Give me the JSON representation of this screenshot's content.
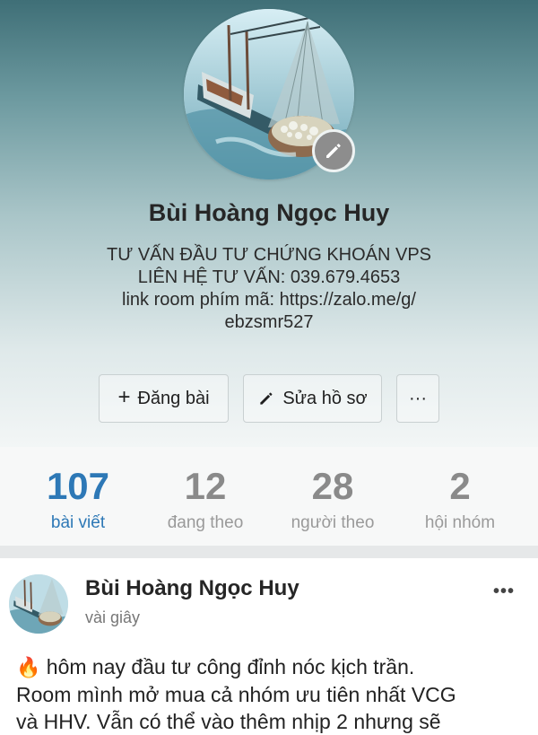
{
  "profile": {
    "name": "Bùi Hoàng Ngọc Huy",
    "bio_lines": [
      "TƯ VẤN ĐẦU TƯ CHỨNG KHOÁN VPS",
      "LIÊN HỆ TƯ VẤN: 039.679.4653",
      "link room phím mã: https://zalo.me/g/",
      "ebzsmr527"
    ]
  },
  "actions": {
    "post_label": "Đăng bài",
    "edit_label": "Sửa hồ sơ",
    "more_label": "···"
  },
  "stats": [
    {
      "value": "107",
      "label": "bài viết"
    },
    {
      "value": "12",
      "label": "đang theo"
    },
    {
      "value": "28",
      "label": "người theo"
    },
    {
      "value": "2",
      "label": "hội nhóm"
    }
  ],
  "post": {
    "author": "Bùi Hoàng Ngọc Huy",
    "time": "vài giây",
    "menu": "•••",
    "icon": "🔥",
    "text_lines": [
      "hôm nay đầu tư công đỉnh nóc kịch trần.",
      "Room mình mở mua cả nhóm ưu tiên nhất VCG",
      "và HHV. Vẫn có thể vào thêm nhịp 2 nhưng sẽ"
    ]
  },
  "colors": {
    "accent": "#2d78b6"
  }
}
